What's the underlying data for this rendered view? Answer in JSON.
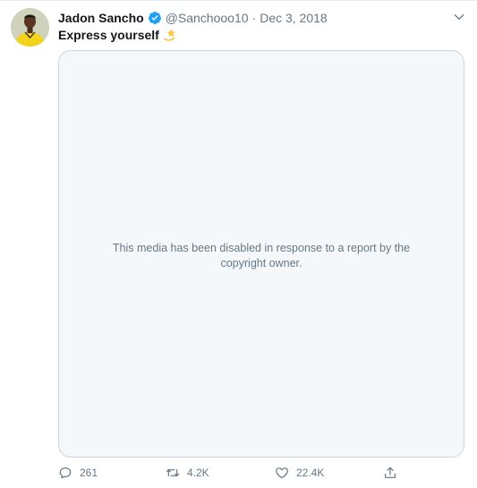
{
  "tweet": {
    "author": {
      "display_name": "Jadon Sancho",
      "handle": "@Sanchooo10",
      "verified": true
    },
    "separator": "·",
    "date": "Dec 3, 2018",
    "text": "Express yourself",
    "emoji_icon": "dizzy-star-icon",
    "media": {
      "message": "This media has been disabled in response to a report by the copyright owner."
    },
    "actions": {
      "replies": "261",
      "retweets": "4.2K",
      "likes": "22.4K"
    }
  },
  "colors": {
    "text_primary": "#14171a",
    "text_secondary": "#657786",
    "verified_blue": "#1da1f2",
    "media_bg": "#f5f8fa",
    "border": "#ccd6dd"
  }
}
